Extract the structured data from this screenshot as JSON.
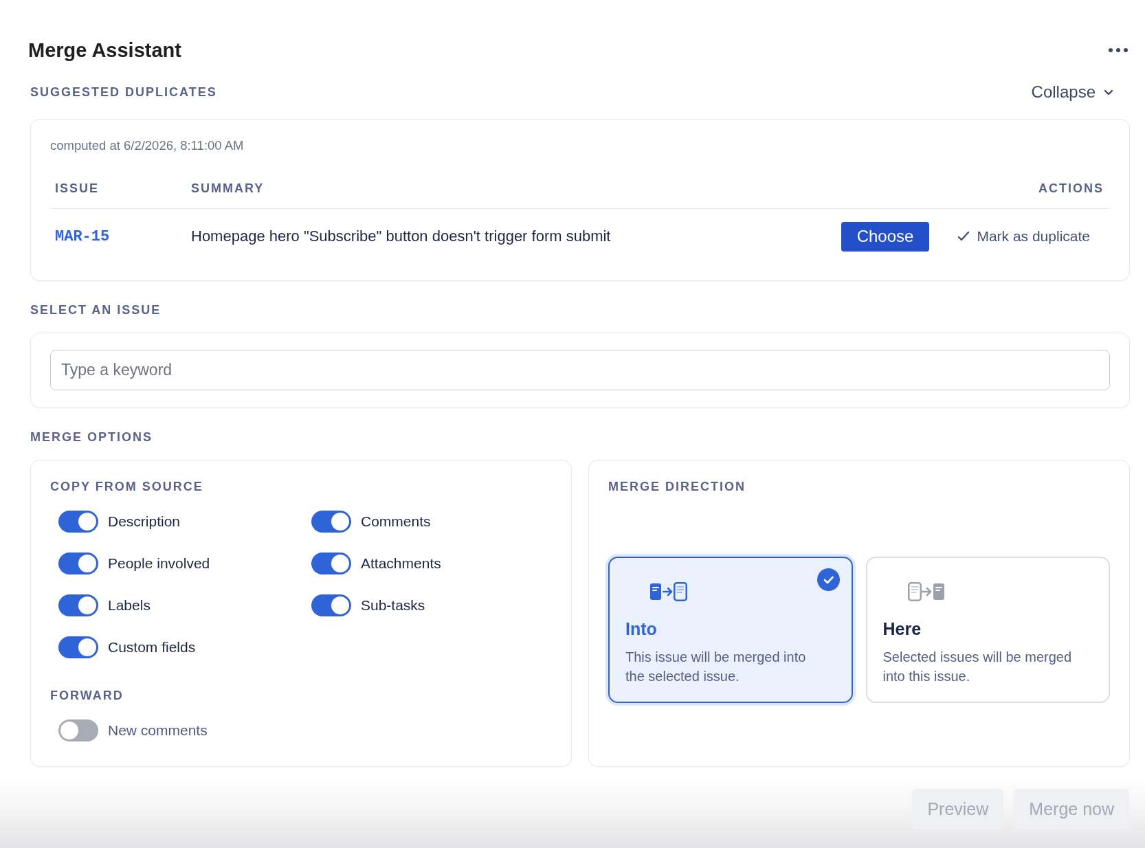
{
  "header": {
    "title": "Merge Assistant"
  },
  "suggested_duplicates": {
    "heading": "SUGGESTED DUPLICATES",
    "collapse_button": "Collapse",
    "computed_at": "computed at 6/2/2026, 8:11:00 AM",
    "columns": [
      "ISSUE",
      "SUMMARY",
      "ACTIONS"
    ],
    "rows": [
      {
        "issue": "MAR-15",
        "summary": "Homepage hero \"Subscribe\" button doesn't trigger form submit",
        "choose_button": "Choose",
        "mark_button": "Mark as duplicate"
      }
    ]
  },
  "select_issue": {
    "heading": "SELECT AN ISSUE",
    "search": {
      "placeholder": "Type a keyword"
    }
  },
  "merge_options": {
    "heading": "MERGE OPTIONS",
    "copy_from_source": {
      "heading": "COPY FROM SOURCE",
      "options": [
        {
          "label": "Description",
          "on": true
        },
        {
          "label": "Comments",
          "on": true
        },
        {
          "label": "People involved",
          "on": true
        },
        {
          "label": "Attachments",
          "on": true
        },
        {
          "label": "Labels",
          "on": true
        },
        {
          "label": "Sub-tasks",
          "on": true
        },
        {
          "label": "Custom fields",
          "on": true
        }
      ]
    },
    "forward": {
      "heading": "FORWARD",
      "options": [
        {
          "label": "New comments",
          "on": false
        }
      ]
    },
    "merge_direction": {
      "heading": "MERGE DIRECTION",
      "choices": [
        {
          "kind": "into",
          "title": "Into",
          "description": "This issue will be merged into the selected issue.",
          "selected": true
        },
        {
          "kind": "here",
          "title": "Here",
          "description": "Selected issues will be merged into this issue.",
          "selected": false
        }
      ]
    }
  },
  "footer": {
    "buttons": [
      {
        "label": "Preview",
        "disabled": true
      },
      {
        "label": "Merge now",
        "disabled": true
      }
    ]
  }
}
